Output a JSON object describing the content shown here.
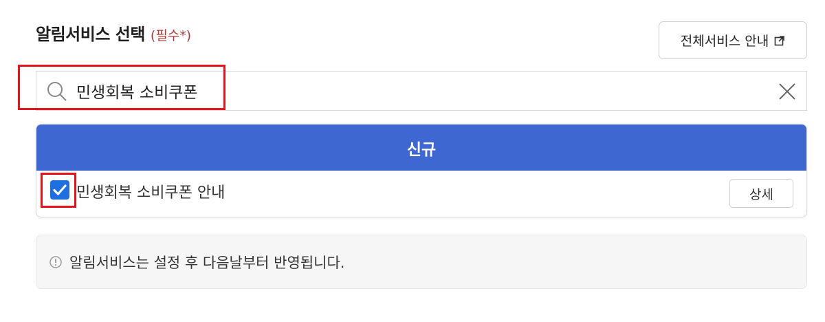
{
  "header": {
    "title": "알림서비스 선택",
    "required": "(필수*)",
    "all_services_label": "전체서비스 안내"
  },
  "search": {
    "value": "민생회복 소비쿠폰",
    "placeholder": ""
  },
  "panel": {
    "header_label": "신규",
    "items": [
      {
        "label": "민생회복 소비쿠폰 안내",
        "checked": true,
        "detail_label": "상세"
      }
    ]
  },
  "notice": {
    "text": "알림서비스는 설정 후 다음날부터 반영됩니다."
  },
  "colors": {
    "accent": "#3e67d1",
    "checkbox": "#1f6fe0",
    "highlight": "#e4141b",
    "required": "#b03a3a"
  },
  "icons": [
    "search-icon",
    "close-icon",
    "external-link-icon",
    "check-icon",
    "info-icon"
  ]
}
